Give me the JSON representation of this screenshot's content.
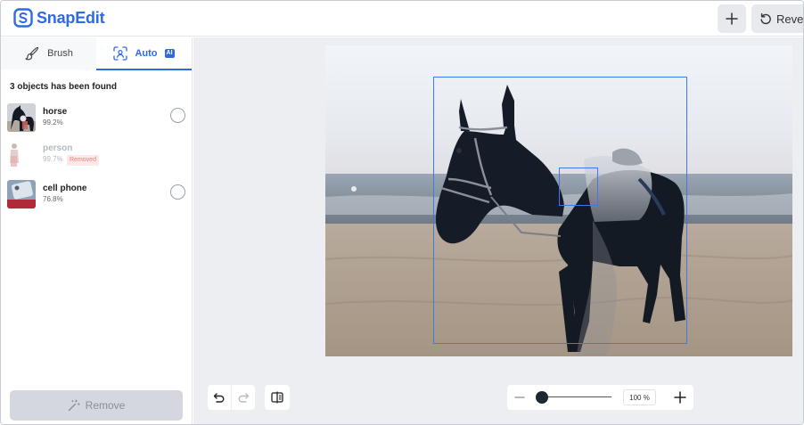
{
  "app": {
    "name": "SnapEdit",
    "accent": "#2f6ae0"
  },
  "header": {
    "add_icon": "plus-icon",
    "revert_label": "Revert"
  },
  "sidebar": {
    "tabs": [
      {
        "label": "Brush",
        "icon": "brush-icon",
        "active": false
      },
      {
        "label": "Auto",
        "icon": "scan-icon",
        "badge": "AI",
        "active": true
      }
    ],
    "found_title": "3 objects has been found",
    "objects": [
      {
        "name": "horse",
        "confidence": "99.2%",
        "removed": false
      },
      {
        "name": "person",
        "confidence": "99.7%",
        "removed": true,
        "badge": "Removed"
      },
      {
        "name": "cell phone",
        "confidence": "76.8%",
        "removed": false
      }
    ],
    "remove_label": "Remove"
  },
  "toolbar": {
    "undo_icon": "undo-icon",
    "redo_icon": "redo-icon",
    "compare_icon": "compare-icon"
  },
  "zoom": {
    "level": "100 %",
    "value": 100
  }
}
